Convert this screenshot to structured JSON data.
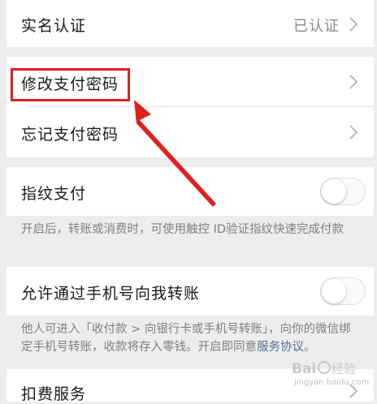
{
  "rows": {
    "real_name": {
      "label": "实名认证",
      "value": "已认证"
    },
    "change_password": {
      "label": "修改支付密码"
    },
    "forgot_password": {
      "label": "忘记支付密码"
    },
    "fingerprint": {
      "label": "指纹支付",
      "enabled": false,
      "note": "开启后，转账或消费时，可使用触控 ID验证指纹快速完成付款"
    },
    "phone_transfer": {
      "label": "允许通过手机号向我转账",
      "enabled": false,
      "note_prefix": "他人可进入「收付款 > 向银行卡或手机号转账」，向你的微信绑定手机号转账，收款将存入零钱。开启即同意",
      "note_link": "服务协议",
      "note_suffix": "。"
    },
    "deduction": {
      "label": "扣费服务"
    }
  },
  "annotation_color": "#e02020",
  "watermark": {
    "brand": "Baidu经验",
    "url": "jingyan.baidu.com"
  }
}
